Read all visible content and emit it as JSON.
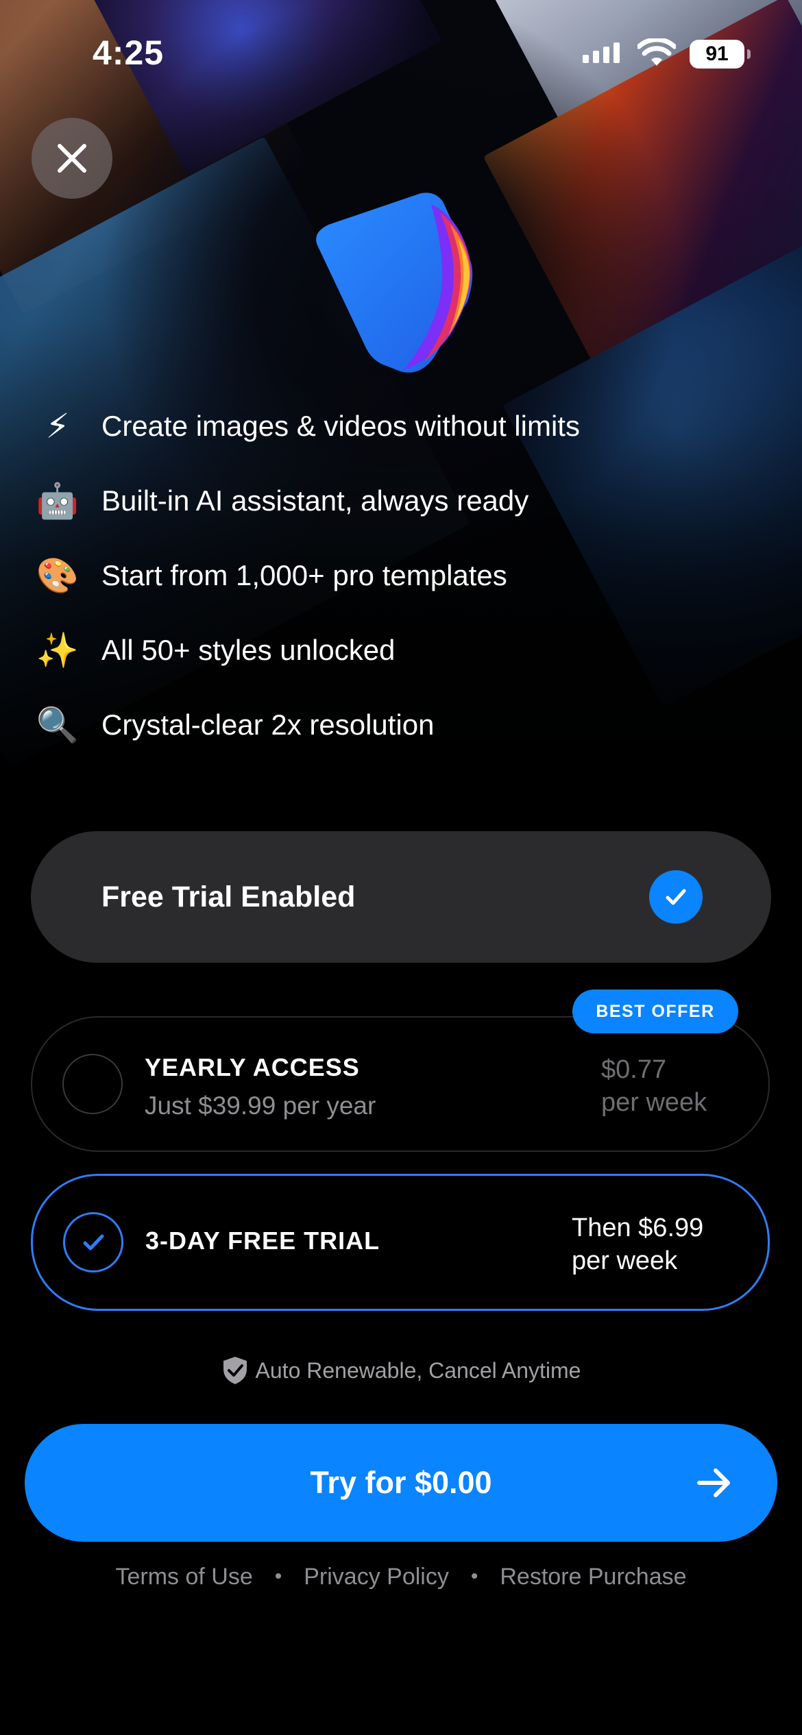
{
  "status_bar": {
    "time": "4:25",
    "battery": "91"
  },
  "features": [
    {
      "icon": "lightning-icon",
      "emoji": "⚡",
      "text": "Create images & videos without limits"
    },
    {
      "icon": "robot-icon",
      "emoji": "🤖",
      "text": "Built-in AI assistant, always ready"
    },
    {
      "icon": "palette-icon",
      "emoji": "🎨",
      "text": "Start from 1,000+ pro templates"
    },
    {
      "icon": "sparkles-icon",
      "emoji": "✨",
      "text": "All 50+ styles unlocked"
    },
    {
      "icon": "magnifier-icon",
      "emoji": "🔍",
      "text": "Crystal-clear 2x resolution"
    }
  ],
  "trial_toggle": {
    "label": "Free Trial Enabled",
    "enabled": true
  },
  "plans": {
    "yearly": {
      "name": "YEARLY ACCESS",
      "subtitle": "Just $39.99 per year",
      "price_line1": "$0.77",
      "price_line2": "per week",
      "badge": "BEST OFFER",
      "selected": false
    },
    "trial": {
      "name": "3-DAY FREE TRIAL",
      "price_line1": "Then $6.99",
      "price_line2": "per week",
      "selected": true
    }
  },
  "renew_note": "Auto Renewable, Cancel Anytime",
  "cta": {
    "label": "Try for $0.00"
  },
  "footer": {
    "terms": "Terms of Use",
    "privacy": "Privacy Policy",
    "restore": "Restore Purchase",
    "separator": "•"
  },
  "colors": {
    "accent": "#0a84ff",
    "toggle_bg": "#2b2b2d",
    "muted": "#8e8e93"
  }
}
